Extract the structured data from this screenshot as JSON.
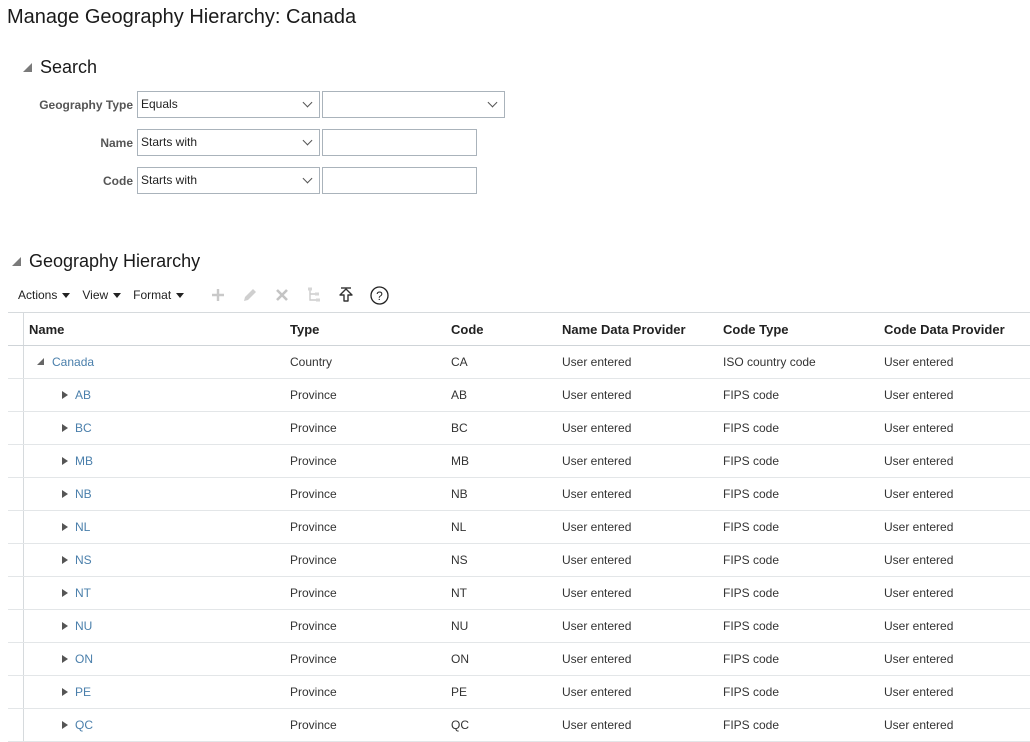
{
  "page": {
    "title": "Manage Geography Hierarchy: Canada"
  },
  "search": {
    "title": "Search",
    "fields": [
      {
        "label": "Geography Type",
        "operator": "Equals",
        "value": ""
      },
      {
        "label": "Name",
        "operator": "Starts with",
        "value": ""
      },
      {
        "label": "Code",
        "operator": "Starts with",
        "value": ""
      }
    ]
  },
  "hierarchy": {
    "title": "Geography Hierarchy",
    "toolbar": {
      "menus": [
        "Actions",
        "View",
        "Format"
      ],
      "icons": [
        "add-icon",
        "edit-icon",
        "delete-icon",
        "hierarchy-icon",
        "go-up-icon",
        "help-icon"
      ]
    },
    "columns": [
      "Name",
      "Type",
      "Code",
      "Name Data Provider",
      "Code Type",
      "Code Data Provider"
    ],
    "rows": [
      {
        "name": "Canada",
        "type": "Country",
        "code": "CA",
        "ndp": "User entered",
        "ctype": "ISO country code",
        "cdp": "User entered"
      },
      {
        "name": "AB",
        "type": "Province",
        "code": "AB",
        "ndp": "User entered",
        "ctype": "FIPS code",
        "cdp": "User entered"
      },
      {
        "name": "BC",
        "type": "Province",
        "code": "BC",
        "ndp": "User entered",
        "ctype": "FIPS code",
        "cdp": "User entered"
      },
      {
        "name": "MB",
        "type": "Province",
        "code": "MB",
        "ndp": "User entered",
        "ctype": "FIPS code",
        "cdp": "User entered"
      },
      {
        "name": "NB",
        "type": "Province",
        "code": "NB",
        "ndp": "User entered",
        "ctype": "FIPS code",
        "cdp": "User entered"
      },
      {
        "name": "NL",
        "type": "Province",
        "code": "NL",
        "ndp": "User entered",
        "ctype": "FIPS code",
        "cdp": "User entered"
      },
      {
        "name": "NS",
        "type": "Province",
        "code": "NS",
        "ndp": "User entered",
        "ctype": "FIPS code",
        "cdp": "User entered"
      },
      {
        "name": "NT",
        "type": "Province",
        "code": "NT",
        "ndp": "User entered",
        "ctype": "FIPS code",
        "cdp": "User entered"
      },
      {
        "name": "NU",
        "type": "Province",
        "code": "NU",
        "ndp": "User entered",
        "ctype": "FIPS code",
        "cdp": "User entered"
      },
      {
        "name": "ON",
        "type": "Province",
        "code": "ON",
        "ndp": "User entered",
        "ctype": "FIPS code",
        "cdp": "User entered"
      },
      {
        "name": "PE",
        "type": "Province",
        "code": "PE",
        "ndp": "User entered",
        "ctype": "FIPS code",
        "cdp": "User entered"
      },
      {
        "name": "QC",
        "type": "Province",
        "code": "QC",
        "ndp": "User entered",
        "ctype": "FIPS code",
        "cdp": "User entered"
      }
    ]
  }
}
